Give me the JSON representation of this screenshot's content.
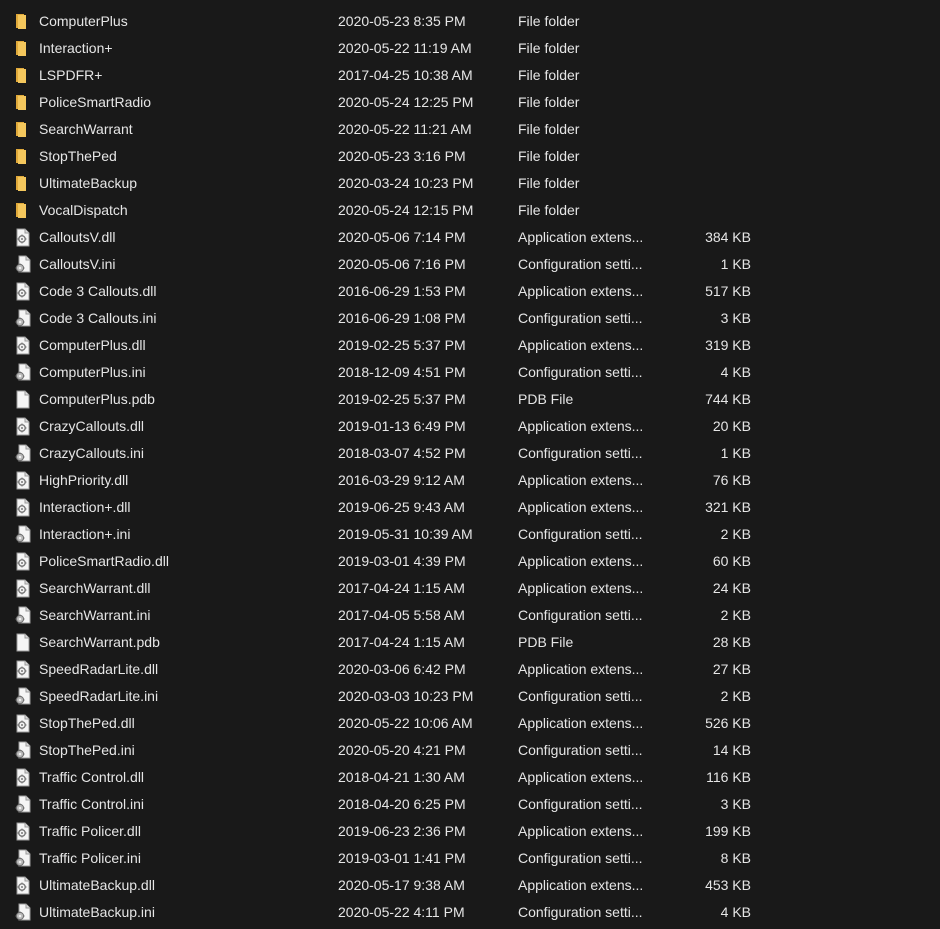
{
  "colors": {
    "background": "#191919",
    "text": "#e6e6e6",
    "folder": "#f4c75c",
    "file": "#f5f5f5"
  },
  "files": [
    {
      "name": "ComputerPlus",
      "date": "2020-05-23 8:35 PM",
      "type": "File folder",
      "size": "",
      "icon": "folder-icon"
    },
    {
      "name": "Interaction+",
      "date": "2020-05-22 11:19 AM",
      "type": "File folder",
      "size": "",
      "icon": "folder-icon"
    },
    {
      "name": "LSPDFR+",
      "date": "2017-04-25 10:38 AM",
      "type": "File folder",
      "size": "",
      "icon": "folder-icon"
    },
    {
      "name": "PoliceSmartRadio",
      "date": "2020-05-24 12:25 PM",
      "type": "File folder",
      "size": "",
      "icon": "folder-icon"
    },
    {
      "name": "SearchWarrant",
      "date": "2020-05-22 11:21 AM",
      "type": "File folder",
      "size": "",
      "icon": "folder-icon"
    },
    {
      "name": "StopThePed",
      "date": "2020-05-23 3:16 PM",
      "type": "File folder",
      "size": "",
      "icon": "folder-icon"
    },
    {
      "name": "UltimateBackup",
      "date": "2020-03-24 10:23 PM",
      "type": "File folder",
      "size": "",
      "icon": "folder-icon"
    },
    {
      "name": "VocalDispatch",
      "date": "2020-05-24 12:15 PM",
      "type": "File folder",
      "size": "",
      "icon": "folder-icon"
    },
    {
      "name": "CalloutsV.dll",
      "date": "2020-05-06 7:14 PM",
      "type": "Application extens...",
      "size": "384 KB",
      "icon": "dll-file-icon"
    },
    {
      "name": "CalloutsV.ini",
      "date": "2020-05-06 7:16 PM",
      "type": "Configuration setti...",
      "size": "1 KB",
      "icon": "ini-file-icon"
    },
    {
      "name": "Code 3 Callouts.dll",
      "date": "2016-06-29 1:53 PM",
      "type": "Application extens...",
      "size": "517 KB",
      "icon": "dll-file-icon"
    },
    {
      "name": "Code 3 Callouts.ini",
      "date": "2016-06-29 1:08 PM",
      "type": "Configuration setti...",
      "size": "3 KB",
      "icon": "ini-file-icon"
    },
    {
      "name": "ComputerPlus.dll",
      "date": "2019-02-25 5:37 PM",
      "type": "Application extens...",
      "size": "319 KB",
      "icon": "dll-file-icon"
    },
    {
      "name": "ComputerPlus.ini",
      "date": "2018-12-09 4:51 PM",
      "type": "Configuration setti...",
      "size": "4 KB",
      "icon": "ini-file-icon"
    },
    {
      "name": "ComputerPlus.pdb",
      "date": "2019-02-25 5:37 PM",
      "type": "PDB File",
      "size": "744 KB",
      "icon": "blank-file-icon"
    },
    {
      "name": "CrazyCallouts.dll",
      "date": "2019-01-13 6:49 PM",
      "type": "Application extens...",
      "size": "20 KB",
      "icon": "dll-file-icon"
    },
    {
      "name": "CrazyCallouts.ini",
      "date": "2018-03-07 4:52 PM",
      "type": "Configuration setti...",
      "size": "1 KB",
      "icon": "ini-file-icon"
    },
    {
      "name": "HighPriority.dll",
      "date": "2016-03-29 9:12 AM",
      "type": "Application extens...",
      "size": "76 KB",
      "icon": "dll-file-icon"
    },
    {
      "name": "Interaction+.dll",
      "date": "2019-06-25 9:43 AM",
      "type": "Application extens...",
      "size": "321 KB",
      "icon": "dll-file-icon"
    },
    {
      "name": "Interaction+.ini",
      "date": "2019-05-31 10:39 AM",
      "type": "Configuration setti...",
      "size": "2 KB",
      "icon": "ini-file-icon"
    },
    {
      "name": "PoliceSmartRadio.dll",
      "date": "2019-03-01 4:39 PM",
      "type": "Application extens...",
      "size": "60 KB",
      "icon": "dll-file-icon"
    },
    {
      "name": "SearchWarrant.dll",
      "date": "2017-04-24 1:15 AM",
      "type": "Application extens...",
      "size": "24 KB",
      "icon": "dll-file-icon"
    },
    {
      "name": "SearchWarrant.ini",
      "date": "2017-04-05 5:58 AM",
      "type": "Configuration setti...",
      "size": "2 KB",
      "icon": "ini-file-icon"
    },
    {
      "name": "SearchWarrant.pdb",
      "date": "2017-04-24 1:15 AM",
      "type": "PDB File",
      "size": "28 KB",
      "icon": "blank-file-icon"
    },
    {
      "name": "SpeedRadarLite.dll",
      "date": "2020-03-06 6:42 PM",
      "type": "Application extens...",
      "size": "27 KB",
      "icon": "dll-file-icon"
    },
    {
      "name": "SpeedRadarLite.ini",
      "date": "2020-03-03 10:23 PM",
      "type": "Configuration setti...",
      "size": "2 KB",
      "icon": "ini-file-icon"
    },
    {
      "name": "StopThePed.dll",
      "date": "2020-05-22 10:06 AM",
      "type": "Application extens...",
      "size": "526 KB",
      "icon": "dll-file-icon"
    },
    {
      "name": "StopThePed.ini",
      "date": "2020-05-20 4:21 PM",
      "type": "Configuration setti...",
      "size": "14 KB",
      "icon": "ini-file-icon"
    },
    {
      "name": "Traffic Control.dll",
      "date": "2018-04-21 1:30 AM",
      "type": "Application extens...",
      "size": "116 KB",
      "icon": "dll-file-icon"
    },
    {
      "name": "Traffic Control.ini",
      "date": "2018-04-20 6:25 PM",
      "type": "Configuration setti...",
      "size": "3 KB",
      "icon": "ini-file-icon"
    },
    {
      "name": "Traffic Policer.dll",
      "date": "2019-06-23 2:36 PM",
      "type": "Application extens...",
      "size": "199 KB",
      "icon": "dll-file-icon"
    },
    {
      "name": "Traffic Policer.ini",
      "date": "2019-03-01 1:41 PM",
      "type": "Configuration setti...",
      "size": "8 KB",
      "icon": "ini-file-icon"
    },
    {
      "name": "UltimateBackup.dll",
      "date": "2020-05-17 9:38 AM",
      "type": "Application extens...",
      "size": "453 KB",
      "icon": "dll-file-icon"
    },
    {
      "name": "UltimateBackup.ini",
      "date": "2020-05-22 4:11 PM",
      "type": "Configuration setti...",
      "size": "4 KB",
      "icon": "ini-file-icon"
    }
  ]
}
